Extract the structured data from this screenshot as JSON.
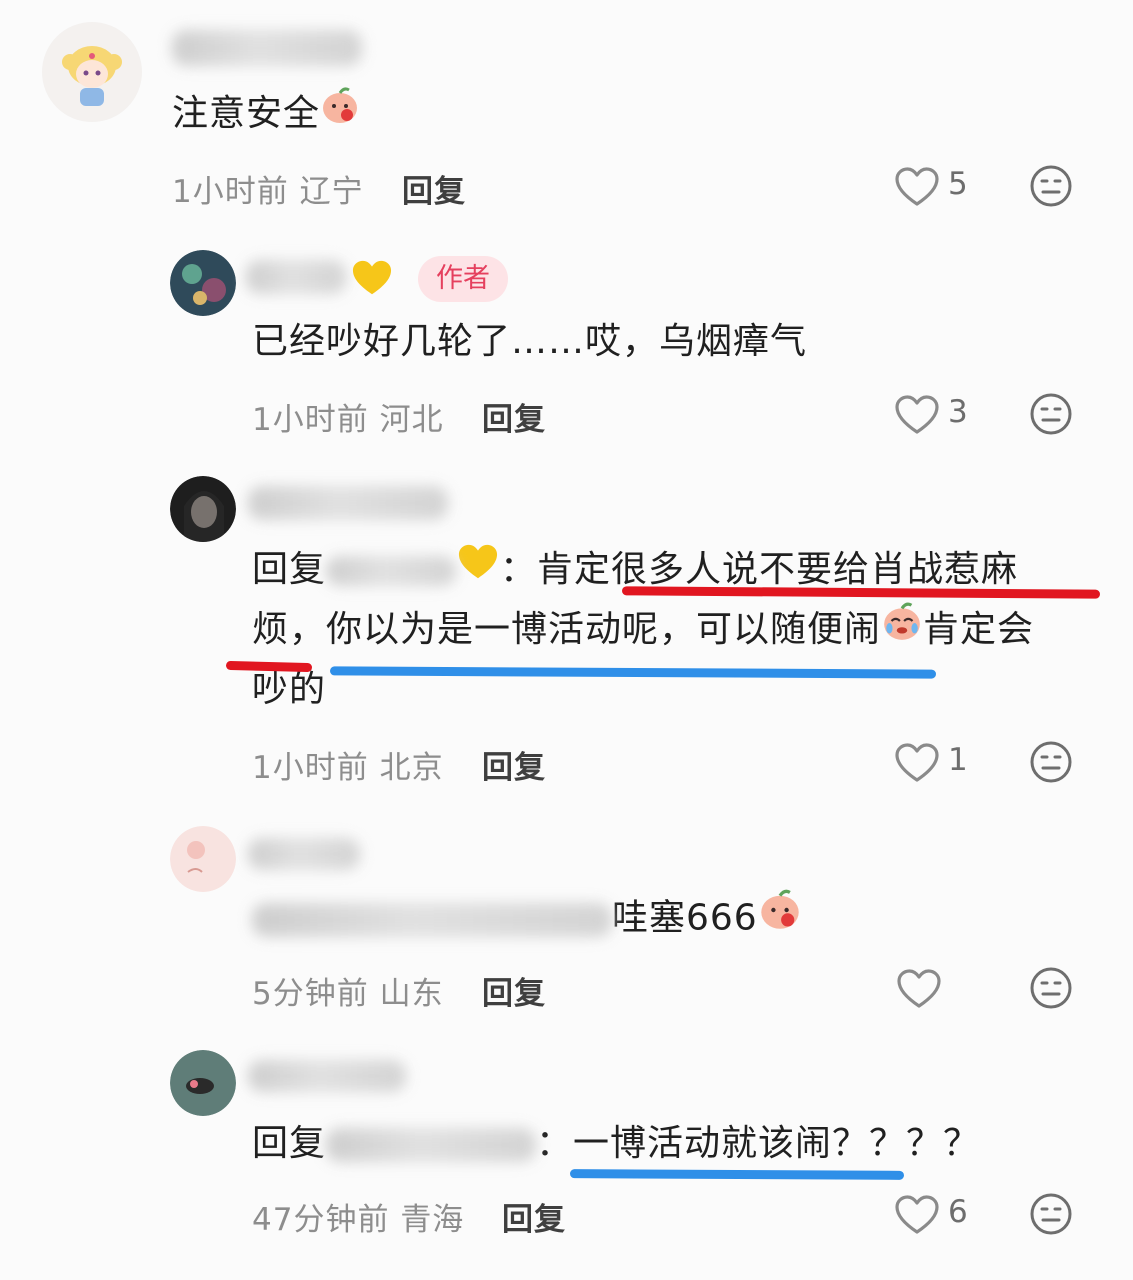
{
  "comments": [
    {
      "text": "注意安全",
      "time": "1小时前",
      "region": "辽宁",
      "reply_label": "回复",
      "likes": "5"
    },
    {
      "badge": "作者",
      "text": "已经吵好几轮了……哎，乌烟瘴气",
      "time": "1小时前",
      "region": "河北",
      "reply_label": "回复",
      "likes": "3"
    },
    {
      "line1_a": "回复",
      "line1_b": "：肯定很多人说不要给肖战惹麻",
      "line2_a": "烦，你以为是一博活动呢，可以随便闹",
      "line2_b": "肯定会",
      "line3": "吵的",
      "time": "1小时前",
      "region": "北京",
      "reply_label": "回复",
      "likes": "1"
    },
    {
      "text": "哇塞666",
      "time": "5分钟前",
      "region": "山东",
      "reply_label": "回复",
      "likes": ""
    },
    {
      "line_a": "回复",
      "line_b": "：一博活动就该闹？？？？",
      "time": "47分钟前",
      "region": "青海",
      "reply_label": "回复",
      "likes": "6"
    }
  ],
  "colors": {
    "annotation_red": "#e11620",
    "annotation_blue": "#2f8fe8",
    "badge_text": "#e5405e",
    "badge_bg": "#fde3e6"
  },
  "icons": [
    "heart-outline-icon",
    "dislike-face-icon",
    "yellow-heart-emoji",
    "peach-face-emoji",
    "crying-peach-emoji"
  ]
}
